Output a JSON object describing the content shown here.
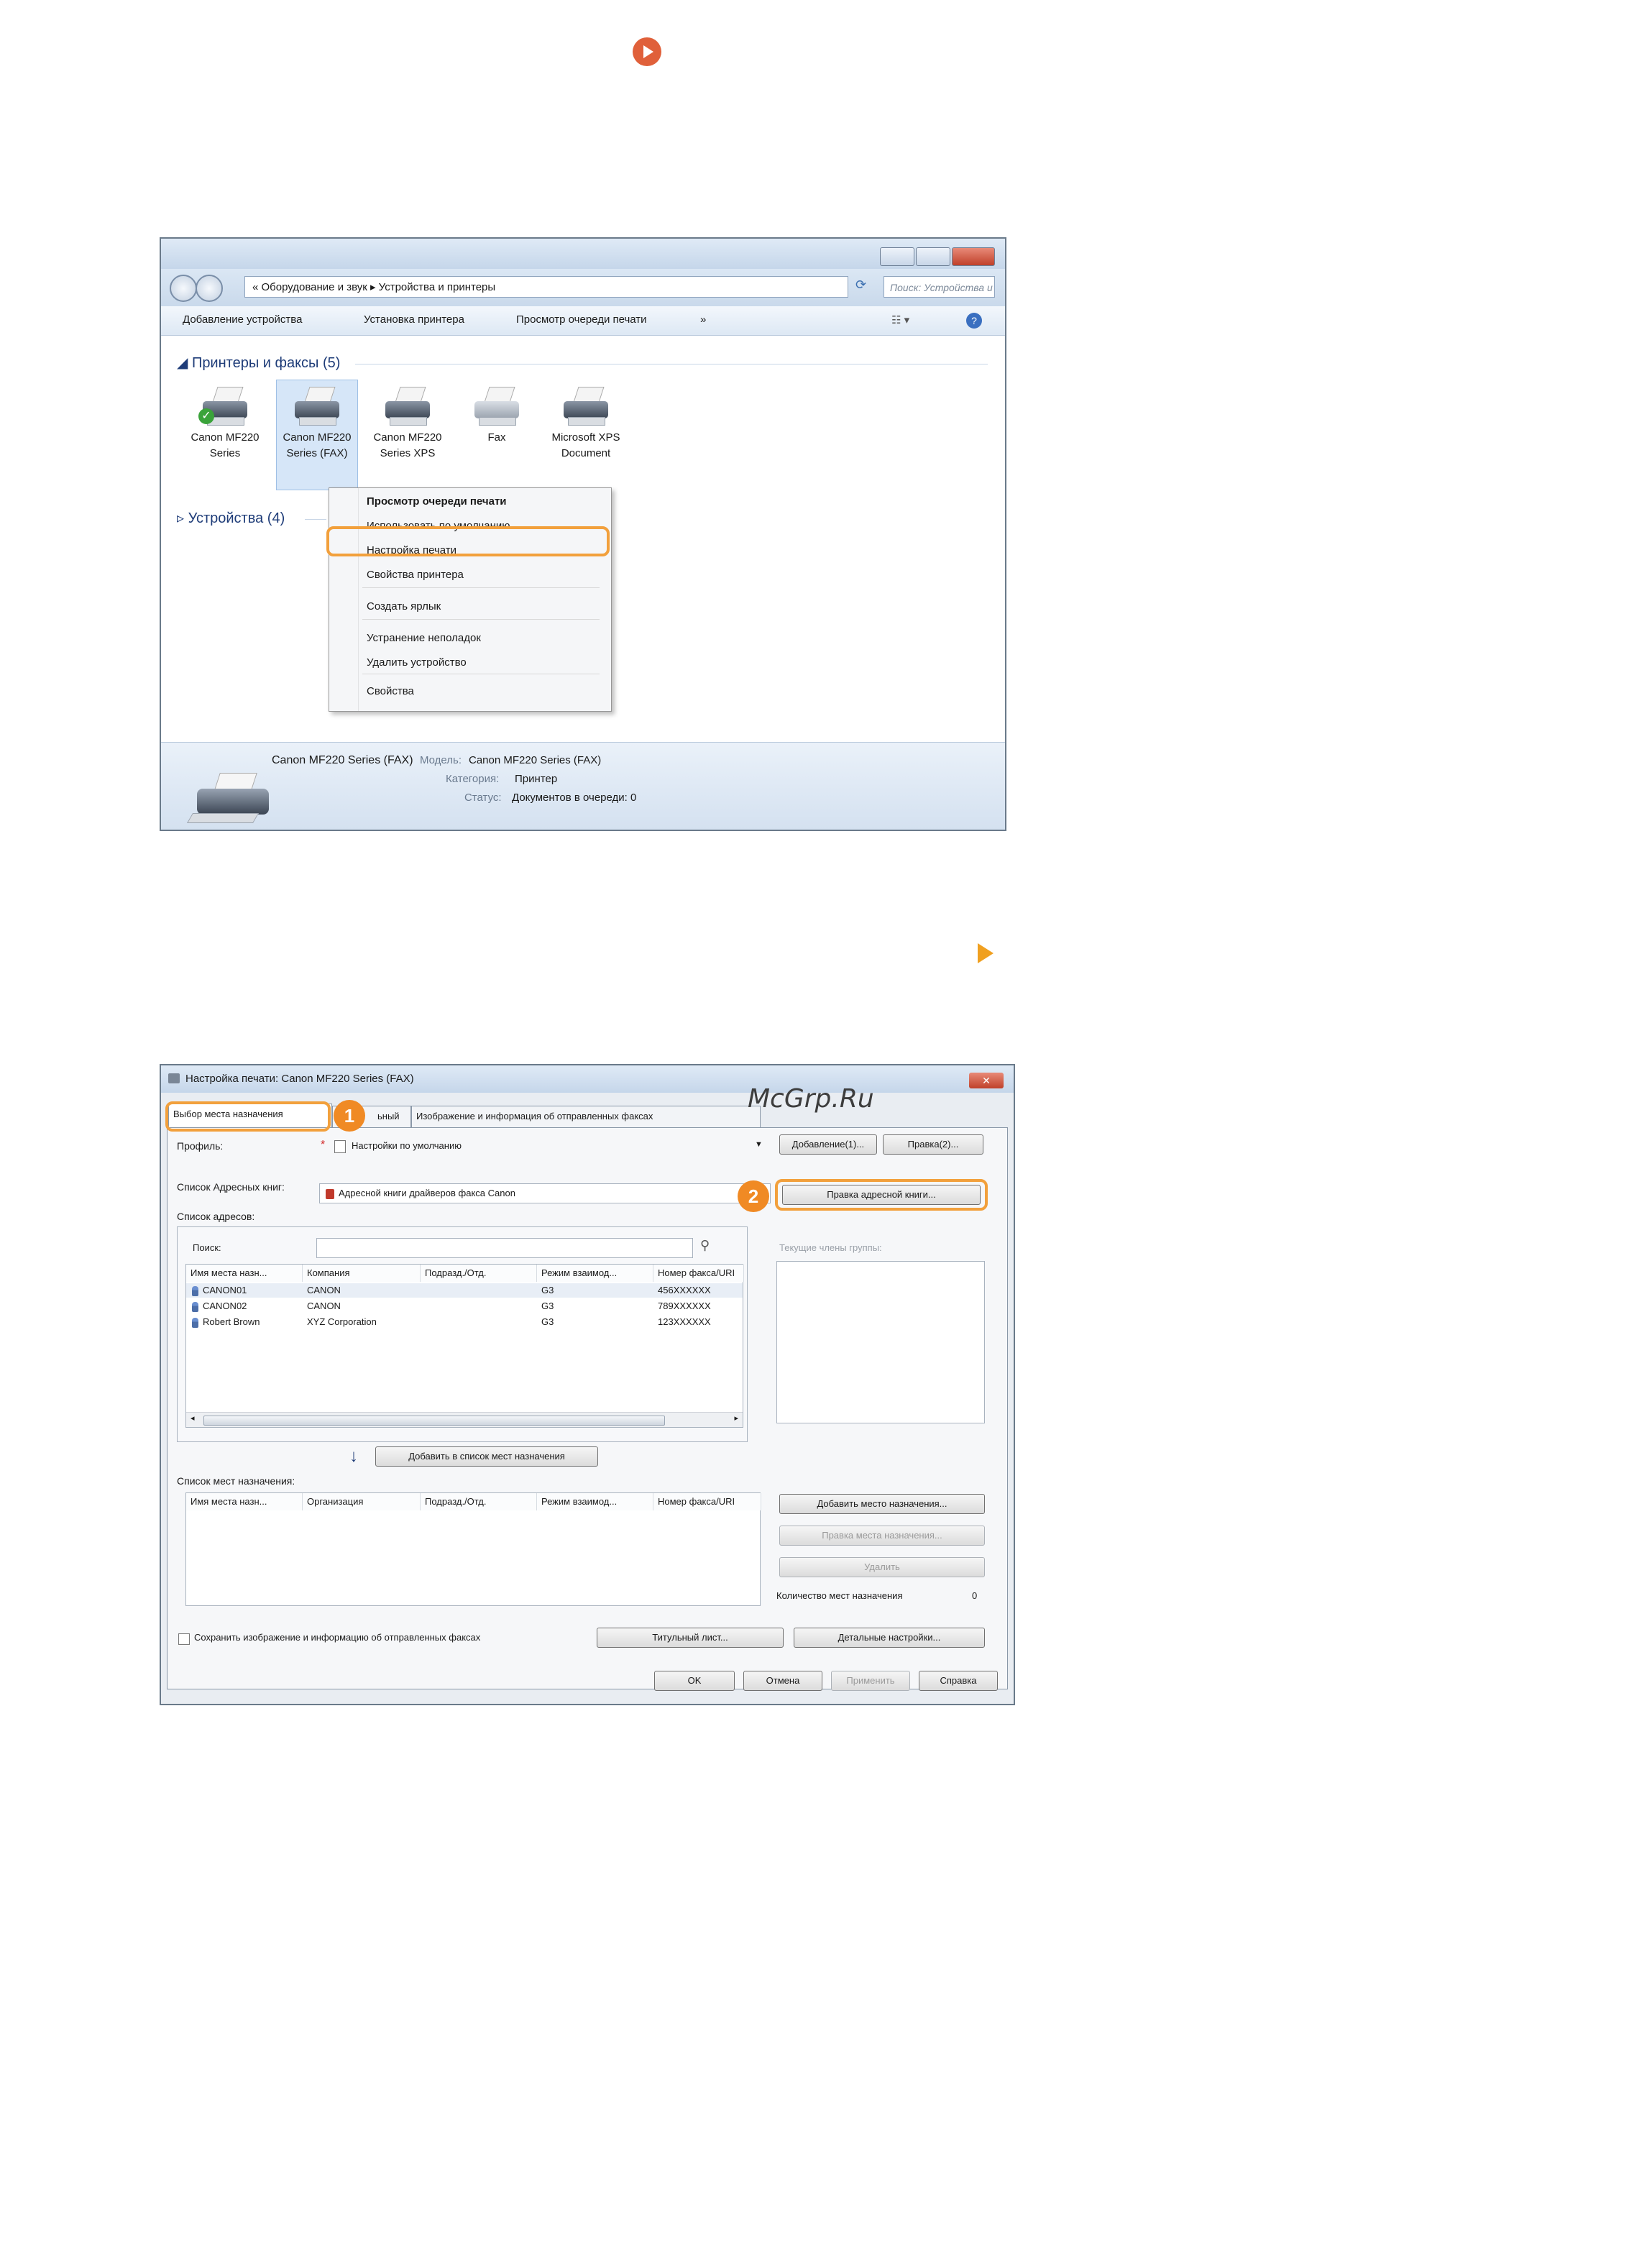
{
  "explorer": {
    "breadcrumb": "« Оборудование и звук ▸ Устройства и принтеры",
    "search_placeholder": "Поиск: Устройства и принтеры",
    "toolbar": {
      "add_device": "Добавление устройства",
      "add_printer": "Установка принтера",
      "print_queue": "Просмотр очереди печати",
      "more": "»"
    },
    "group_printers": "Принтеры и факсы (5)",
    "group_devices": "Устройства (4)",
    "printers": [
      {
        "label": "Canon MF220 Series"
      },
      {
        "label": "Canon MF220 Series (FAX)"
      },
      {
        "label": "Canon MF220 Series XPS"
      },
      {
        "label": "Fax"
      },
      {
        "label": "Microsoft XPS Document"
      }
    ],
    "context_menu": {
      "items": [
        "Просмотр очереди печати",
        "Использовать по умолчанию",
        "Настройка печати",
        "Свойства принтера",
        "Создать ярлык",
        "Устранение неполадок",
        "Удалить устройство",
        "Свойства"
      ]
    },
    "details": {
      "name": "Canon MF220 Series (FAX)",
      "model_label": "Модель:",
      "model_value": "Canon MF220 Series (FAX)",
      "category_label": "Категория:",
      "category_value": "Принтер",
      "status_label": "Статус:",
      "status_value": "Документов в очереди: 0"
    }
  },
  "dialog": {
    "title": "Настройка печати: Canon MF220 Series (FAX)",
    "close": "✕",
    "tabs": [
      "Выбор места назначения",
      "ьный",
      "Изображение и информация об отправленных факсах"
    ],
    "profile_label": "Профиль:",
    "profile_value": "Настройки по умолчанию",
    "add_button": "Добавление(1)...",
    "edit_button": "Правка(2)...",
    "addressbook_label": "Список Адресных книг:",
    "addressbook_value": "Адресной книги драйверов факса Canon",
    "edit_addressbook_button": "Правка адресной книги...",
    "address_list_label": "Список адресов:",
    "search_label": "Поиск:",
    "group_members_label": "Текущие члены группы:",
    "columns": [
      "Имя места назн...",
      "Компания",
      "Подразд./Отд.",
      "Режим взаимод...",
      "Номер факса/URI"
    ],
    "rows": [
      {
        "name": "CANON01",
        "company": "CANON",
        "dept": "",
        "mode": "G3",
        "fax": "456XXXXXX"
      },
      {
        "name": "CANON02",
        "company": "CANON",
        "dept": "",
        "mode": "G3",
        "fax": "789XXXXXX"
      },
      {
        "name": "Robert Brown",
        "company": "XYZ Corporation",
        "dept": "",
        "mode": "G3",
        "fax": "123XXXXXX"
      }
    ],
    "add_to_dest_button": "Добавить в список мест назначения",
    "dest_list_label": "Список мест назначения:",
    "dest_columns": [
      "Имя места назн...",
      "Организация",
      "Подразд./Отд.",
      "Режим взаимод...",
      "Номер факса/URI"
    ],
    "add_dest_button": "Добавить место назначения...",
    "edit_dest_button": "Правка места назначения...",
    "delete_button": "Удалить",
    "dest_count_label": "Количество мест назначения",
    "dest_count_value": "0",
    "save_checkbox_label": "Сохранить изображение и информацию об отправленных факсах",
    "cover_button": "Титульный лист...",
    "details_button": "Детальные настройки...",
    "ok": "OK",
    "cancel": "Отмена",
    "apply": "Применить",
    "help": "Справка"
  },
  "callouts": [
    "1",
    "2"
  ],
  "watermark": "McGrp.Ru",
  "colors": {
    "highlight": "#f2a03c",
    "callout": "#f08a24",
    "accent_icon": "#e0603a"
  }
}
